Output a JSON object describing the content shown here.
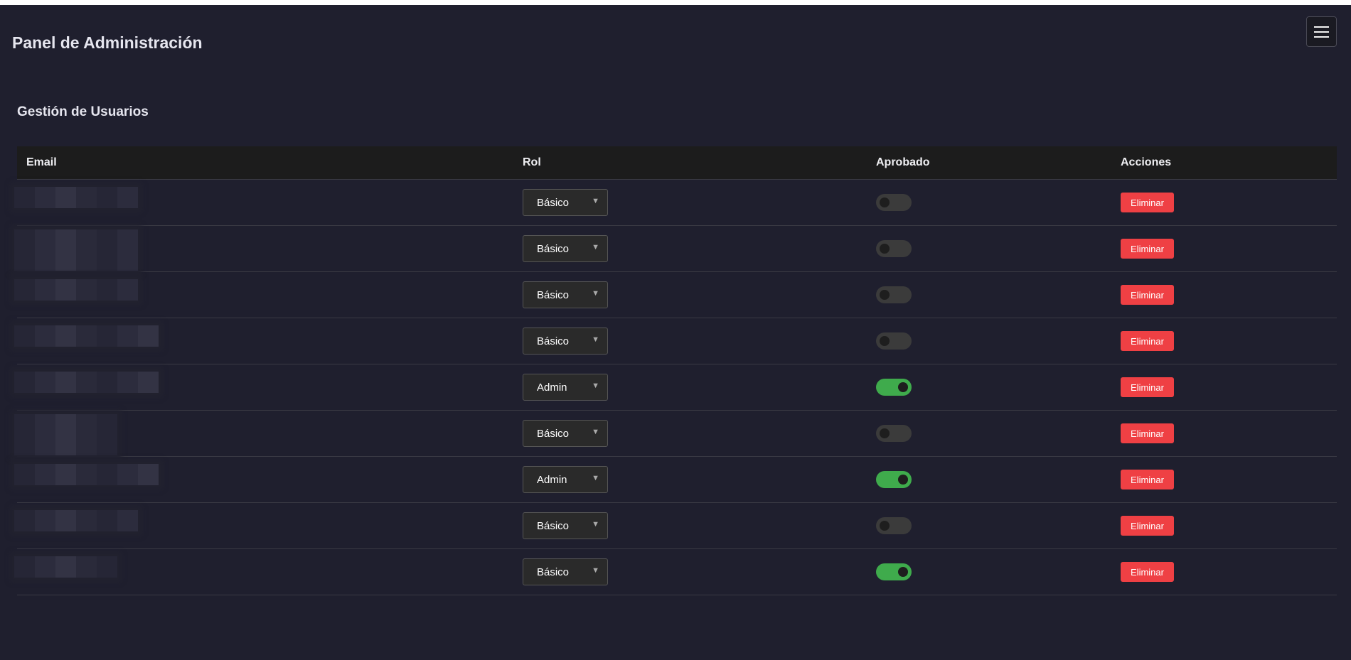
{
  "header": {
    "title": "Panel de Administración",
    "menu_icon": "hamburger-menu-icon"
  },
  "users_section": {
    "title": "Gestión de Usuarios",
    "columns": [
      "Email",
      "Rol",
      "Aprobado",
      "Acciones"
    ],
    "rows": [
      {
        "email": "",
        "role": "Básico",
        "approved": false,
        "action": "Eliminar"
      },
      {
        "email": "",
        "role": "Básico",
        "approved": false,
        "action": "Eliminar"
      },
      {
        "email": "",
        "role": "Básico",
        "approved": false,
        "action": "Eliminar"
      },
      {
        "email": "",
        "role": "Básico",
        "approved": false,
        "action": "Eliminar"
      },
      {
        "email": "",
        "role": "Admin",
        "approved": true,
        "action": "Eliminar"
      },
      {
        "email": "",
        "role": "Básico",
        "approved": false,
        "action": "Eliminar"
      },
      {
        "email": "",
        "role": "Admin",
        "approved": true,
        "action": "Eliminar"
      },
      {
        "email": "",
        "role": "Básico",
        "approved": false,
        "action": "Eliminar"
      },
      {
        "email": "",
        "role": "Básico",
        "approved": true,
        "action": "Eliminar"
      }
    ]
  },
  "colors": {
    "background": "#1f1f2e",
    "approved_on": "#3fab4c",
    "approved_off": "#3b3b3b",
    "delete_button": "#ef4044"
  }
}
